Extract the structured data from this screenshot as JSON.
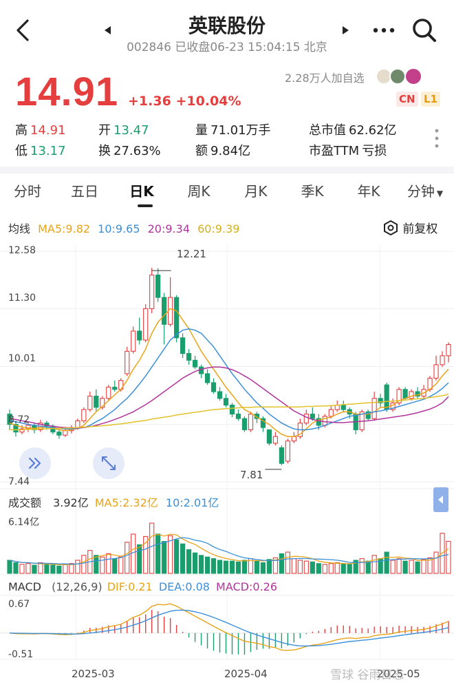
{
  "header": {
    "title": "英联股份",
    "subtitle": "002846 已收盘06-23 15:04:15 北京"
  },
  "quote": {
    "price": "14.91",
    "change": "+1.36",
    "change_pct": "+10.04%",
    "followers": "2.28万人加自选",
    "badge_cn": "CN",
    "badge_l1": "L1"
  },
  "stats": [
    {
      "label": "高",
      "value": "14.91",
      "color": "red"
    },
    {
      "label": "开",
      "value": "13.47",
      "color": "green"
    },
    {
      "label": "量",
      "value": "71.01万手",
      "color": "black"
    },
    {
      "label": "总市值",
      "value": "62.62亿",
      "color": "black"
    },
    {
      "label": "低",
      "value": "13.17",
      "color": "green"
    },
    {
      "label": "换",
      "value": "27.63%",
      "color": "black"
    },
    {
      "label": "额",
      "value": "9.84亿",
      "color": "black"
    },
    {
      "label": "市盈TTM",
      "value": "亏损",
      "color": "black"
    }
  ],
  "tabs": [
    "分时",
    "五日",
    "日K",
    "周K",
    "月K",
    "季K",
    "年K",
    "分钟"
  ],
  "active_tab": 2,
  "ma": {
    "title": "均线",
    "ma5": "MA5:9.82",
    "ma10": "10:9.65",
    "ma20": "20:9.34",
    "ma60": "60:9.39",
    "adjust": "前复权"
  },
  "price_axis": {
    "labels": [
      "12.58",
      "11.30",
      "10.01",
      "8.72",
      "7.44"
    ],
    "high_mark": "12.21",
    "low_mark": "7.81"
  },
  "volume": {
    "title": "成交额",
    "value": "3.92亿",
    "ma5": "MA5:2.32亿",
    "ma10": "10:2.01亿",
    "axis_max": "6.14亿"
  },
  "macd": {
    "title": "MACD",
    "params": "(12,26,9)",
    "dif": "DIF:0.21",
    "dea": "DEA:0.08",
    "macd": "MACD:0.26",
    "axis_max": "0.67",
    "axis_min": "-0.51"
  },
  "x_axis": [
    "2025-03",
    "2025-04",
    "2025-05"
  ],
  "watermark": "雪球 谷雨日志",
  "colors": {
    "up": "#e53e3e",
    "down": "#1a9e6e",
    "ma5": "#e8a317",
    "ma10": "#3b8fd9",
    "ma20": "#b0349b",
    "ma60": "#e3c229"
  },
  "chart_data": {
    "type": "candlestick",
    "ylim": [
      7.44,
      12.58
    ],
    "candles": [
      {
        "o": 8.95,
        "c": 8.72,
        "h": 9.05,
        "l": 8.6
      },
      {
        "o": 8.72,
        "c": 8.55,
        "h": 8.8,
        "l": 8.45
      },
      {
        "o": 8.55,
        "c": 8.62,
        "h": 8.7,
        "l": 8.5
      },
      {
        "o": 8.62,
        "c": 8.7,
        "h": 8.78,
        "l": 8.55
      },
      {
        "o": 8.7,
        "c": 8.6,
        "h": 8.75,
        "l": 8.52
      },
      {
        "o": 8.6,
        "c": 8.75,
        "h": 8.82,
        "l": 8.55
      },
      {
        "o": 8.75,
        "c": 8.68,
        "h": 8.8,
        "l": 8.6
      },
      {
        "o": 8.68,
        "c": 8.55,
        "h": 8.72,
        "l": 8.5
      },
      {
        "o": 8.55,
        "c": 8.48,
        "h": 8.6,
        "l": 8.4
      },
      {
        "o": 8.48,
        "c": 8.58,
        "h": 8.65,
        "l": 8.44
      },
      {
        "o": 8.58,
        "c": 8.65,
        "h": 8.7,
        "l": 8.52
      },
      {
        "o": 8.65,
        "c": 8.8,
        "h": 8.85,
        "l": 8.6
      },
      {
        "o": 8.8,
        "c": 9.05,
        "h": 9.1,
        "l": 8.75
      },
      {
        "o": 9.05,
        "c": 9.35,
        "h": 9.45,
        "l": 9.0
      },
      {
        "o": 9.35,
        "c": 9.1,
        "h": 9.5,
        "l": 9.0
      },
      {
        "o": 9.1,
        "c": 9.3,
        "h": 9.35,
        "l": 9.05
      },
      {
        "o": 9.3,
        "c": 9.55,
        "h": 9.6,
        "l": 9.25
      },
      {
        "o": 9.55,
        "c": 9.5,
        "h": 9.7,
        "l": 9.45
      },
      {
        "o": 9.5,
        "c": 9.7,
        "h": 9.75,
        "l": 9.45
      },
      {
        "o": 9.85,
        "c": 10.35,
        "h": 10.45,
        "l": 9.8
      },
      {
        "o": 10.35,
        "c": 10.8,
        "h": 10.9,
        "l": 10.3
      },
      {
        "o": 10.8,
        "c": 10.6,
        "h": 11.1,
        "l": 10.5
      },
      {
        "o": 10.6,
        "c": 11.3,
        "h": 11.4,
        "l": 10.55
      },
      {
        "o": 11.3,
        "c": 12.05,
        "h": 12.21,
        "l": 11.2
      },
      {
        "o": 12.05,
        "c": 11.55,
        "h": 12.2,
        "l": 11.45
      },
      {
        "o": 11.55,
        "c": 10.95,
        "h": 11.65,
        "l": 10.5
      },
      {
        "o": 10.95,
        "c": 11.55,
        "h": 12.0,
        "l": 10.9
      },
      {
        "o": 11.55,
        "c": 10.65,
        "h": 11.6,
        "l": 10.55
      },
      {
        "o": 10.65,
        "c": 10.3,
        "h": 10.75,
        "l": 10.2
      },
      {
        "o": 10.3,
        "c": 10.15,
        "h": 10.4,
        "l": 10.05
      },
      {
        "o": 10.15,
        "c": 10.0,
        "h": 10.25,
        "l": 9.95
      },
      {
        "o": 10.0,
        "c": 9.85,
        "h": 10.05,
        "l": 9.75
      },
      {
        "o": 9.85,
        "c": 9.65,
        "h": 9.95,
        "l": 9.6
      },
      {
        "o": 9.65,
        "c": 9.45,
        "h": 9.75,
        "l": 9.4
      },
      {
        "o": 9.45,
        "c": 9.3,
        "h": 9.55,
        "l": 9.25
      },
      {
        "o": 9.3,
        "c": 9.15,
        "h": 9.4,
        "l": 9.1
      },
      {
        "o": 9.15,
        "c": 8.95,
        "h": 9.2,
        "l": 8.88
      },
      {
        "o": 8.95,
        "c": 8.85,
        "h": 9.05,
        "l": 8.8
      },
      {
        "o": 8.85,
        "c": 8.6,
        "h": 8.9,
        "l": 8.55
      },
      {
        "o": 8.6,
        "c": 8.95,
        "h": 9.0,
        "l": 8.55
      },
      {
        "o": 8.95,
        "c": 8.85,
        "h": 9.0,
        "l": 8.75
      },
      {
        "o": 8.85,
        "c": 8.65,
        "h": 8.9,
        "l": 8.55
      },
      {
        "o": 8.6,
        "c": 8.3,
        "h": 8.6,
        "l": 8.25
      },
      {
        "o": 8.3,
        "c": 8.45,
        "h": 8.55,
        "l": 8.25
      },
      {
        "o": 8.2,
        "c": 7.85,
        "h": 8.25,
        "l": 7.81
      },
      {
        "o": 7.9,
        "c": 8.35,
        "h": 8.4,
        "l": 7.85
      },
      {
        "o": 8.35,
        "c": 8.45,
        "h": 8.55,
        "l": 8.3
      },
      {
        "o": 8.45,
        "c": 8.75,
        "h": 8.85,
        "l": 8.4
      },
      {
        "o": 8.75,
        "c": 8.95,
        "h": 9.05,
        "l": 8.7
      },
      {
        "o": 8.95,
        "c": 8.85,
        "h": 9.1,
        "l": 8.8
      },
      {
        "o": 8.85,
        "c": 8.7,
        "h": 8.95,
        "l": 8.6
      },
      {
        "o": 8.7,
        "c": 8.9,
        "h": 8.95,
        "l": 8.65
      },
      {
        "o": 8.9,
        "c": 9.05,
        "h": 9.15,
        "l": 8.85
      },
      {
        "o": 9.05,
        "c": 9.15,
        "h": 9.25,
        "l": 9.0
      },
      {
        "o": 9.15,
        "c": 9.05,
        "h": 9.25,
        "l": 9.0
      },
      {
        "o": 9.05,
        "c": 8.95,
        "h": 9.1,
        "l": 8.85
      },
      {
        "o": 8.95,
        "c": 8.6,
        "h": 9.0,
        "l": 8.5
      },
      {
        "o": 8.6,
        "c": 9.0,
        "h": 9.05,
        "l": 8.55
      },
      {
        "o": 9.0,
        "c": 8.85,
        "h": 9.05,
        "l": 8.8
      },
      {
        "o": 8.85,
        "c": 9.3,
        "h": 9.45,
        "l": 8.8
      },
      {
        "o": 9.3,
        "c": 9.2,
        "h": 9.4,
        "l": 9.1
      },
      {
        "o": 9.6,
        "c": 9.05,
        "h": 9.65,
        "l": 9.0
      },
      {
        "o": 9.05,
        "c": 9.2,
        "h": 9.3,
        "l": 9.0
      },
      {
        "o": 9.2,
        "c": 9.5,
        "h": 9.55,
        "l": 9.15
      },
      {
        "o": 9.5,
        "c": 9.3,
        "h": 9.55,
        "l": 9.25
      },
      {
        "o": 9.3,
        "c": 9.45,
        "h": 9.5,
        "l": 9.25
      },
      {
        "o": 9.45,
        "c": 9.35,
        "h": 9.55,
        "l": 9.3
      },
      {
        "o": 9.35,
        "c": 9.5,
        "h": 9.6,
        "l": 9.3
      },
      {
        "o": 9.5,
        "c": 9.75,
        "h": 9.8,
        "l": 9.45
      },
      {
        "o": 9.75,
        "c": 10.05,
        "h": 10.25,
        "l": 9.7
      },
      {
        "o": 10.05,
        "c": 10.25,
        "h": 10.35,
        "l": 10.0
      },
      {
        "o": 10.25,
        "c": 10.5,
        "h": 10.55,
        "l": 10.1
      }
    ],
    "ma": {
      "ma5": [
        8.75,
        8.7,
        8.66,
        8.64,
        8.63,
        8.65,
        8.66,
        8.64,
        8.6,
        8.58,
        8.6,
        8.63,
        8.7,
        8.85,
        9.0,
        9.12,
        9.25,
        9.38,
        9.5,
        9.7,
        9.95,
        10.15,
        10.4,
        10.75,
        11.0,
        11.15,
        11.3,
        11.25,
        11.05,
        10.85,
        10.6,
        10.35,
        10.15,
        9.95,
        9.75,
        9.55,
        9.38,
        9.2,
        9.05,
        8.98,
        8.88,
        8.8,
        8.72,
        8.6,
        8.5,
        8.45,
        8.45,
        8.5,
        8.62,
        8.75,
        8.82,
        8.85,
        8.88,
        8.95,
        9.0,
        9.0,
        8.95,
        8.95,
        8.95,
        9.0,
        9.1,
        9.1,
        9.15,
        9.25,
        9.3,
        9.35,
        9.38,
        9.42,
        9.5,
        9.62,
        9.8,
        9.95
      ],
      "ma10": [
        8.8,
        8.78,
        8.75,
        8.72,
        8.7,
        8.68,
        8.66,
        8.65,
        8.63,
        8.62,
        8.62,
        8.63,
        8.65,
        8.7,
        8.78,
        8.85,
        8.95,
        9.05,
        9.18,
        9.3,
        9.45,
        9.62,
        9.8,
        10.0,
        10.2,
        10.4,
        10.6,
        10.72,
        10.82,
        10.85,
        10.82,
        10.75,
        10.6,
        10.45,
        10.25,
        10.05,
        9.85,
        9.68,
        9.5,
        9.35,
        9.2,
        9.08,
        8.95,
        8.85,
        8.75,
        8.68,
        8.62,
        8.6,
        8.6,
        8.62,
        8.65,
        8.7,
        8.75,
        8.8,
        8.85,
        8.9,
        8.92,
        8.95,
        8.97,
        9.0,
        9.02,
        9.05,
        9.08,
        9.12,
        9.16,
        9.2,
        9.24,
        9.28,
        9.34,
        9.42,
        9.52,
        9.65
      ],
      "ma20": [
        8.85,
        8.83,
        8.8,
        8.78,
        8.75,
        8.72,
        8.7,
        8.68,
        8.66,
        8.65,
        8.64,
        8.64,
        8.65,
        8.67,
        8.7,
        8.74,
        8.78,
        8.83,
        8.88,
        8.94,
        9.0,
        9.08,
        9.16,
        9.25,
        9.35,
        9.45,
        9.55,
        9.65,
        9.75,
        9.83,
        9.9,
        9.95,
        9.98,
        10.0,
        10.0,
        9.98,
        9.94,
        9.88,
        9.8,
        9.72,
        9.62,
        9.52,
        9.42,
        9.32,
        9.22,
        9.12,
        9.02,
        8.95,
        8.88,
        8.83,
        8.8,
        8.78,
        8.77,
        8.76,
        8.76,
        8.77,
        8.78,
        8.79,
        8.8,
        8.82,
        8.84,
        8.86,
        8.88,
        8.9,
        8.92,
        8.95,
        8.98,
        9.02,
        9.06,
        9.12,
        9.2,
        9.34
      ],
      "ma60": [
        8.6,
        8.6,
        8.6,
        8.61,
        8.61,
        8.62,
        8.62,
        8.63,
        8.63,
        8.64,
        8.64,
        8.65,
        8.66,
        8.67,
        8.68,
        8.69,
        8.7,
        8.72,
        8.73,
        8.75,
        8.77,
        8.79,
        8.81,
        8.84,
        8.86,
        8.88,
        8.9,
        8.93,
        8.95,
        8.97,
        8.99,
        9.01,
        9.03,
        9.05,
        9.06,
        9.07,
        9.08,
        9.09,
        9.1,
        9.1,
        9.11,
        9.11,
        9.11,
        9.11,
        9.11,
        9.11,
        9.11,
        9.11,
        9.12,
        9.12,
        9.13,
        9.13,
        9.14,
        9.15,
        9.16,
        9.17,
        9.18,
        9.19,
        9.2,
        9.21,
        9.22,
        9.23,
        9.24,
        9.25,
        9.26,
        9.28,
        9.29,
        9.3,
        9.32,
        9.34,
        9.36,
        9.39
      ]
    },
    "volume_max": 6.14,
    "volumes": [
      1.6,
      1.3,
      1.1,
      1.2,
      1.0,
      1.3,
      1.1,
      1.0,
      0.9,
      1.1,
      1.2,
      1.6,
      2.2,
      2.8,
      2.2,
      2.0,
      2.4,
      1.8,
      2.0,
      3.8,
      4.8,
      3.5,
      4.5,
      6.14,
      4.8,
      3.9,
      4.6,
      4.1,
      3.6,
      2.9,
      2.5,
      2.2,
      2.0,
      1.8,
      1.6,
      1.5,
      1.5,
      1.4,
      1.6,
      1.8,
      1.5,
      1.3,
      1.7,
      1.9,
      2.4,
      2.6,
      1.8,
      1.6,
      1.5,
      1.4,
      1.2,
      1.1,
      1.2,
      1.3,
      1.2,
      1.1,
      1.6,
      1.8,
      1.5,
      2.2,
      1.8,
      2.6,
      1.6,
      1.8,
      1.5,
      1.6,
      1.4,
      1.7,
      1.9,
      2.6,
      4.9,
      3.92
    ],
    "macd_range": [
      -0.51,
      0.67
    ]
  }
}
